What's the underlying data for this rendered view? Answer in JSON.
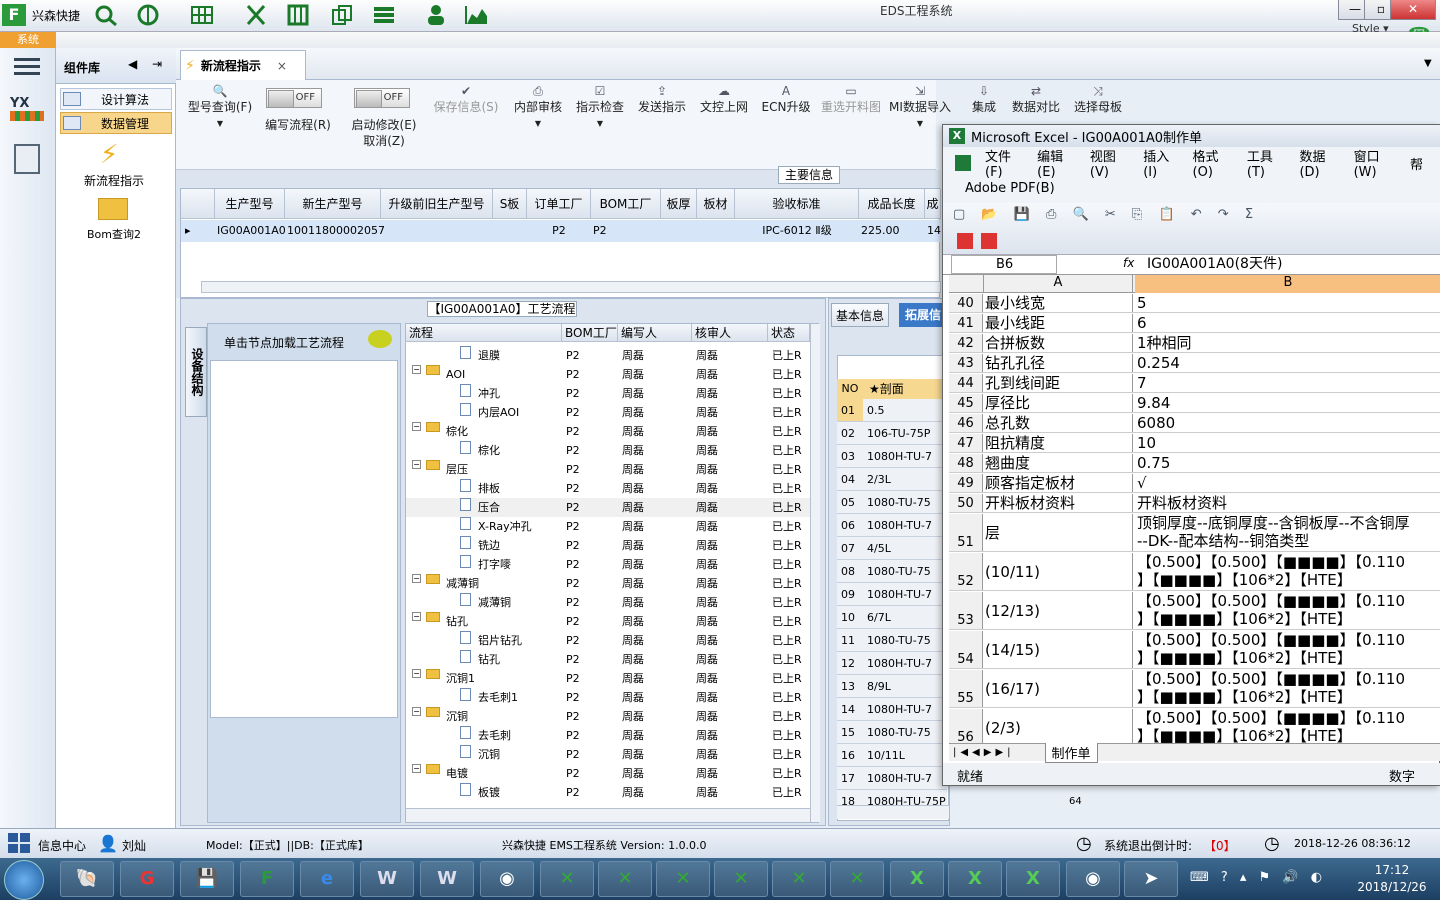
{
  "titlebar": {
    "app_name": "兴森快捷",
    "window_title": "EDS工程系统",
    "style_label": "Style ▾"
  },
  "sys_tab": "系统",
  "component_panel": {
    "title": "组件库",
    "items": [
      {
        "label": "设计算法"
      },
      {
        "label": "数据管理"
      },
      {
        "label": "新流程指示"
      },
      {
        "label": "Bom查询2"
      }
    ]
  },
  "tab": {
    "label": "新流程指示",
    "close": "×"
  },
  "toolbar": {
    "model_query": "型号查询(F)",
    "toggle_off": "OFF",
    "edit_process": "编写流程(R)",
    "enable_edit": "启动修改(E)",
    "cancel": "取消(Z)",
    "save_info": "保存信息(S)",
    "internal_review": "内部审核",
    "indicator_check": "指示检查",
    "send_indicator": "发送指示",
    "doc_upload": "文控上网",
    "ecn_upgrade": "ECN升级",
    "reselect_drawing": "重选开料图",
    "mi_import": "MI数据导入",
    "integrate": "集成",
    "data_compare": "数据对比",
    "select_master": "选择母板"
  },
  "main_info": {
    "section_title": "主要信息",
    "columns": [
      "生产型号",
      "新生产型号",
      "升级前旧生产型号",
      "S板",
      "订单工厂",
      "BOM工厂",
      "板厚",
      "板材",
      "验收标准",
      "成品长度",
      "成"
    ],
    "row": {
      "model": "IG00A001A0",
      "new_model": "10011800002057",
      "old_model": "",
      "s_board": "",
      "order_factory": "P2",
      "bom_factory": "P2",
      "thickness": "",
      "material": "",
      "standard": "IPC-6012 Ⅱ级",
      "length": "225.00",
      "extra": "14"
    }
  },
  "process": {
    "section_title": "【IG00A001A0】工艺流程",
    "vtab": "设备结构",
    "node_hint": "单击节点加载工艺流程",
    "columns": [
      "流程",
      "BOM工厂",
      "编写人",
      "核审人",
      "状态"
    ],
    "rows": [
      {
        "level": 2,
        "type": "doc",
        "name": "退膜",
        "factory": "P2",
        "writer": "周磊",
        "reviewer": "周磊",
        "status": "已上R"
      },
      {
        "level": 1,
        "type": "folder",
        "name": "AOI",
        "factory": "P2",
        "writer": "周磊",
        "reviewer": "周磊",
        "status": "已上R"
      },
      {
        "level": 2,
        "type": "doc",
        "name": "冲孔",
        "factory": "P2",
        "writer": "周磊",
        "reviewer": "周磊",
        "status": "已上R"
      },
      {
        "level": 2,
        "type": "doc",
        "name": "内层AOI",
        "factory": "P2",
        "writer": "周磊",
        "reviewer": "周磊",
        "status": "已上R"
      },
      {
        "level": 1,
        "type": "folder",
        "name": "棕化",
        "factory": "P2",
        "writer": "周磊",
        "reviewer": "周磊",
        "status": "已上R"
      },
      {
        "level": 2,
        "type": "doc",
        "name": "棕化",
        "factory": "P2",
        "writer": "周磊",
        "reviewer": "周磊",
        "status": "已上R"
      },
      {
        "level": 1,
        "type": "folder",
        "name": "层压",
        "factory": "P2",
        "writer": "周磊",
        "reviewer": "周磊",
        "status": "已上R"
      },
      {
        "level": 2,
        "type": "doc",
        "name": "排板",
        "factory": "P2",
        "writer": "周磊",
        "reviewer": "周磊",
        "status": "已上R"
      },
      {
        "level": 2,
        "type": "doc",
        "name": "压合",
        "factory": "P2",
        "writer": "周磊",
        "reviewer": "周磊",
        "status": "已上R",
        "selected": true
      },
      {
        "level": 2,
        "type": "doc",
        "name": "X-Ray冲孔",
        "factory": "P2",
        "writer": "周磊",
        "reviewer": "周磊",
        "status": "已上R"
      },
      {
        "level": 2,
        "type": "doc",
        "name": "铣边",
        "factory": "P2",
        "writer": "周磊",
        "reviewer": "周磊",
        "status": "已上R"
      },
      {
        "level": 2,
        "type": "doc",
        "name": "打字嘜",
        "factory": "P2",
        "writer": "周磊",
        "reviewer": "周磊",
        "status": "已上R"
      },
      {
        "level": 1,
        "type": "folder",
        "name": "减薄铜",
        "factory": "P2",
        "writer": "周磊",
        "reviewer": "周磊",
        "status": "已上R"
      },
      {
        "level": 2,
        "type": "doc",
        "name": "减薄铜",
        "factory": "P2",
        "writer": "周磊",
        "reviewer": "周磊",
        "status": "已上R"
      },
      {
        "level": 1,
        "type": "folder",
        "name": "钻孔",
        "factory": "P2",
        "writer": "周磊",
        "reviewer": "周磊",
        "status": "已上R"
      },
      {
        "level": 2,
        "type": "doc",
        "name": "铝片钻孔",
        "factory": "P2",
        "writer": "周磊",
        "reviewer": "周磊",
        "status": "已上R"
      },
      {
        "level": 2,
        "type": "doc",
        "name": "钻孔",
        "factory": "P2",
        "writer": "周磊",
        "reviewer": "周磊",
        "status": "已上R"
      },
      {
        "level": 1,
        "type": "folder",
        "name": "沉铜1",
        "factory": "P2",
        "writer": "周磊",
        "reviewer": "周磊",
        "status": "已上R"
      },
      {
        "level": 2,
        "type": "doc",
        "name": "去毛刺1",
        "factory": "P2",
        "writer": "周磊",
        "reviewer": "周磊",
        "status": "已上R"
      },
      {
        "level": 1,
        "type": "folder",
        "name": "沉铜",
        "factory": "P2",
        "writer": "周磊",
        "reviewer": "周磊",
        "status": "已上R"
      },
      {
        "level": 2,
        "type": "doc",
        "name": "去毛刺",
        "factory": "P2",
        "writer": "周磊",
        "reviewer": "周磊",
        "status": "已上R"
      },
      {
        "level": 2,
        "type": "doc",
        "name": "沉铜",
        "factory": "P2",
        "writer": "周磊",
        "reviewer": "周磊",
        "status": "已上R"
      },
      {
        "level": 1,
        "type": "folder",
        "name": "电镀",
        "factory": "P2",
        "writer": "周磊",
        "reviewer": "周磊",
        "status": "已上R"
      },
      {
        "level": 2,
        "type": "doc",
        "name": "板镀",
        "factory": "P2",
        "writer": "周磊",
        "reviewer": "周磊",
        "status": "已上R"
      }
    ]
  },
  "basic_info": {
    "tab_basic": "基本信息",
    "tab_ext": "拓展信",
    "col_no": "NO",
    "col_val": "★剖面",
    "rows": [
      {
        "no": "01",
        "val": "0.5"
      },
      {
        "no": "02",
        "val": "106-TU-75P"
      },
      {
        "no": "03",
        "val": "1080H-TU-7"
      },
      {
        "no": "04",
        "val": "2/3L"
      },
      {
        "no": "05",
        "val": "1080-TU-75"
      },
      {
        "no": "06",
        "val": "1080H-TU-7"
      },
      {
        "no": "07",
        "val": "4/5L"
      },
      {
        "no": "08",
        "val": "1080-TU-75"
      },
      {
        "no": "09",
        "val": "1080H-TU-7"
      },
      {
        "no": "10",
        "val": "6/7L"
      },
      {
        "no": "11",
        "val": "1080-TU-75"
      },
      {
        "no": "12",
        "val": "1080H-TU-7"
      },
      {
        "no": "13",
        "val": "8/9L"
      },
      {
        "no": "14",
        "val": "1080H-TU-7"
      },
      {
        "no": "15",
        "val": "1080-TU-75"
      },
      {
        "no": "16",
        "val": "10/11L"
      },
      {
        "no": "17",
        "val": "1080H-TU-7"
      },
      {
        "no": "18",
        "val": "1080H-TU-75P"
      }
    ],
    "extra_val": "64"
  },
  "excel": {
    "title": "Microsoft Excel - IG00A001A0制作单",
    "menus": [
      "文件(F)",
      "编辑(E)",
      "视图(V)",
      "插入(I)",
      "格式(O)",
      "工具(T)",
      "数据(D)",
      "窗口(W)",
      "帮"
    ],
    "adobe": "Adobe PDF(B)",
    "cell_ref": "B6",
    "fx": "fx",
    "formula": "IG00A001A0(8天件)",
    "col_a": "A",
    "col_b": "B",
    "rows": [
      {
        "n": "40",
        "a": "最小线宽",
        "b": "5",
        "h": 19
      },
      {
        "n": "41",
        "a": "最小线距",
        "b": "6",
        "h": 19
      },
      {
        "n": "42",
        "a": "合拼板数",
        "b": "1种相同",
        "h": 19
      },
      {
        "n": "43",
        "a": "钻孔孔径",
        "b": "0.254",
        "h": 19
      },
      {
        "n": "44",
        "a": "孔到线间距",
        "b": "7",
        "h": 19
      },
      {
        "n": "45",
        "a": "厚径比",
        "b": "9.84",
        "h": 19
      },
      {
        "n": "46",
        "a": "总孔数",
        "b": "6080",
        "h": 19
      },
      {
        "n": "47",
        "a": "阻抗精度",
        "b": "10",
        "h": 19
      },
      {
        "n": "48",
        "a": "翘曲度",
        "b": "0.75",
        "h": 19
      },
      {
        "n": "49",
        "a": "顾客指定板材",
        "b": "√",
        "h": 19
      },
      {
        "n": "50",
        "a": "开料板材资料",
        "b": "开料板材资料",
        "h": 19
      },
      {
        "n": "51",
        "a": "层",
        "b": "顶铜厚度--底铜厚度--含铜板厚--不含铜厚",
        "b2": "--DK--配本结构--铜箔类型",
        "h": 38
      },
      {
        "n": "52",
        "a": "(10/11)",
        "b": "【0.500】【0.500】【■■■■】【0.110",
        "b2": "】【■■■■】【106*2】【HTE】",
        "h": 38
      },
      {
        "n": "53",
        "a": "(12/13)",
        "b": "【0.500】【0.500】【■■■■】【0.110",
        "b2": "】【■■■■】【106*2】【HTE】",
        "h": 38
      },
      {
        "n": "54",
        "a": "(14/15)",
        "b": "【0.500】【0.500】【■■■■】【0.110",
        "b2": "】【■■■■】【106*2】【HTE】",
        "h": 38
      },
      {
        "n": "55",
        "a": "(16/17)",
        "b": "【0.500】【0.500】【■■■■】【0.110",
        "b2": "】【■■■■】【106*2】【HTE】",
        "h": 38
      },
      {
        "n": "56",
        "a": "(2/3)",
        "b": "【0.500】【0.500】【■■■■】【0.110",
        "b2": "】【■■■■】【106*2】【HTE】",
        "h": 38
      }
    ],
    "sheet_tab": "制作单",
    "status_ready": "就绪",
    "status_num": "数字"
  },
  "statusbar": {
    "info_center": "信息中心",
    "user": "刘灿",
    "model_db": "Model:【正式】||DB:【正式库】",
    "version": "兴森快捷 EMS工程系统 Version: 1.0.0.0",
    "logout_label": "系统退出倒计时:",
    "logout_value": "【0】",
    "datetime": "2018-12-26 08:36:12"
  },
  "taskbar": {
    "time": "17:12",
    "date": "2018/12/26"
  }
}
